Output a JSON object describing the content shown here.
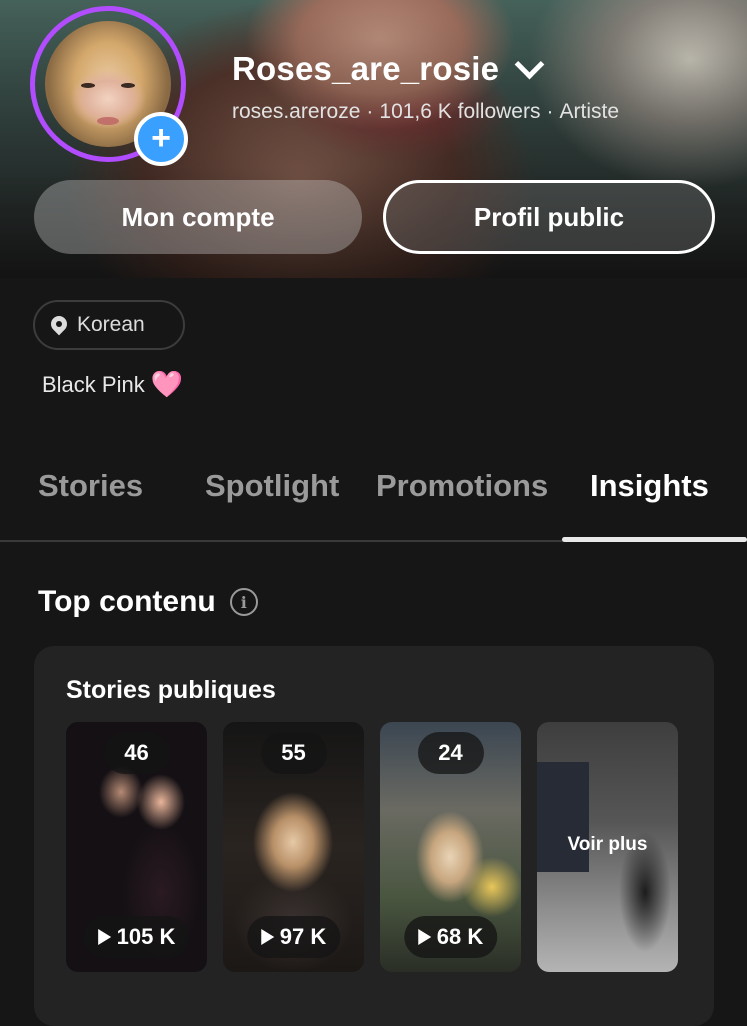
{
  "profile": {
    "display_name": "Roses_are_rosie",
    "handle": "roses.areroze",
    "followers": "101,6 K followers",
    "category": "Artiste",
    "add_icon": "plus-icon"
  },
  "actions": {
    "account_label": "Mon compte",
    "public_profile_label": "Profil public"
  },
  "location": {
    "label": "Korean",
    "icon": "location-pin-icon"
  },
  "bio": {
    "text": "Black Pink",
    "emoji": "🩷"
  },
  "tabs": [
    {
      "label": "Stories",
      "active": false
    },
    {
      "label": "Spotlight",
      "active": false
    },
    {
      "label": "Promotions",
      "active": false
    },
    {
      "label": "Insights",
      "active": true
    }
  ],
  "top_content": {
    "title": "Top contenu",
    "info_icon": "info-icon",
    "card_title": "Stories publiques",
    "stories": [
      {
        "count": "46",
        "views": "105 K"
      },
      {
        "count": "55",
        "views": "97 K"
      },
      {
        "count": "24",
        "views": "68 K"
      }
    ],
    "see_more_label": "Voir plus"
  },
  "colors": {
    "avatar_ring": "#b24dff",
    "add_button": "#3aa0ff",
    "background": "#161616",
    "card": "#232323",
    "heart": "#ff9fcf"
  }
}
